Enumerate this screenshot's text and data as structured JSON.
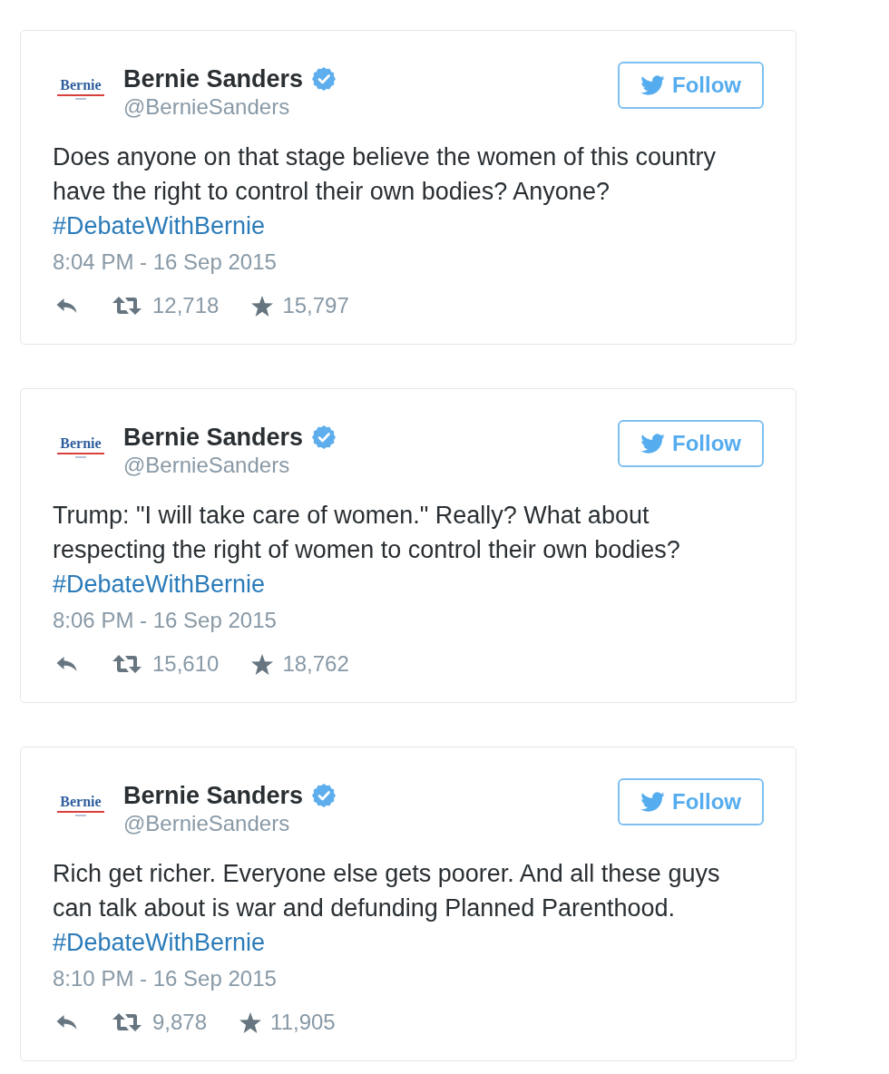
{
  "tweets": [
    {
      "logo": "Bernie",
      "name": "Bernie Sanders",
      "verified": true,
      "handle": "@BernieSanders",
      "follow_button": "Follow",
      "text": "Does anyone on that stage believe the women of this country have the right to control their own bodies? Anyone?",
      "hashtag": "#DebateWithBernie",
      "timestamp": "8:04 PM - 16 Sep 2015",
      "retweets": "12,718",
      "favorites": "15,797"
    },
    {
      "logo": "Bernie",
      "name": "Bernie Sanders",
      "verified": true,
      "handle": "@BernieSanders",
      "follow_button": "Follow",
      "text": "Trump: \"I will take care of women.\" Really? What about respecting the right of women to control their own bodies?",
      "hashtag": "#DebateWithBernie",
      "timestamp": "8:06 PM - 16 Sep 2015",
      "retweets": "15,610",
      "favorites": "18,762"
    },
    {
      "logo": "Bernie",
      "name": "Bernie Sanders",
      "verified": true,
      "handle": "@BernieSanders",
      "follow_button": "Follow",
      "text": "Rich get richer. Everyone else gets poorer. And all these guys can talk about is war and defunding Planned Parenthood.",
      "hashtag": "#DebateWithBernie",
      "timestamp": "8:10 PM - 16 Sep 2015",
      "retweets": "9,878",
      "favorites": "11,905"
    }
  ]
}
